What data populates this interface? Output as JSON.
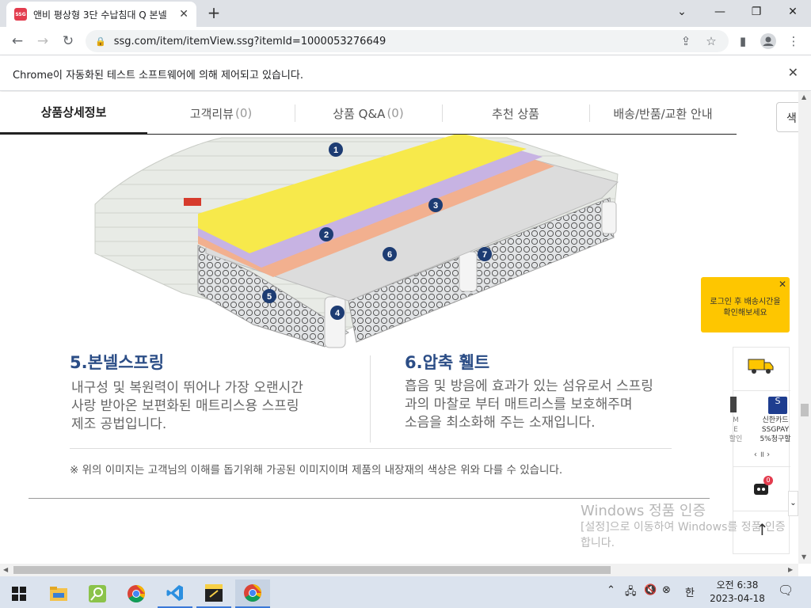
{
  "browser": {
    "tab_title": "앤비 평상형 3단 수납침대 Q 본넬",
    "favicon_text": "SSG",
    "new_tab": "+",
    "url": "ssg.com/item/itemView.ssg?itemId=1000053276649",
    "infobar": "Chrome이 자동화된 테스트 소프트웨어에 의해 제어되고 있습니다."
  },
  "page_tabs": [
    {
      "label": "상품상세정보",
      "count": ""
    },
    {
      "label": "고객리뷰",
      "count": "(0)"
    },
    {
      "label": "상품 Q&A",
      "count": "(0)"
    },
    {
      "label": "추천 상품",
      "count": ""
    },
    {
      "label": "배송/반품/교환 안내",
      "count": ""
    }
  ],
  "side_search": "색",
  "diagram_markers": [
    "1",
    "2",
    "3",
    "4",
    "5",
    "6",
    "7"
  ],
  "features": [
    {
      "title": "5.본넬스프링",
      "lines": [
        "내구성 및 복원력이 뛰어나 가장 오랜시간",
        "사랑 받아온 보편화된 매트리스용 스프링",
        "제조 공법입니다."
      ]
    },
    {
      "title": "6.압축 휄트",
      "lines": [
        "흡음 및 방음에 효과가 있는 섬유로서 스프링",
        "과의 마찰로 부터 매트리스를 보호해주며",
        "소음을 최소화해 주는 소재입니다."
      ]
    }
  ],
  "note": "※ 위의 이미지는 고객님의 이해를 돕기위해 가공된 이미지이며 제품의 내장재의 색상은 위와 다를 수 있습니다.",
  "floating": {
    "tooltip": [
      "로그인 후 배송시간을",
      "확인해보세요"
    ],
    "card_left": [
      "M",
      "E",
      "할인"
    ],
    "card_right": [
      "신한카드",
      "SSGPAY",
      "5%청구할"
    ],
    "cart_badge": "0"
  },
  "watermark": {
    "title": "Windows 정품 인증",
    "body": "[설정]으로 이동하여 Windows를 정품 인증합니다."
  },
  "taskbar": {
    "time": "오전 6:38",
    "date": "2023-04-18",
    "ime": "한"
  },
  "colors": {
    "accent_blue": "#2b4d86",
    "tooltip_yellow": "#fec600",
    "yellow_layer": "#f7e94b",
    "purple_layer": "#c7b3e3",
    "salmon_layer": "#f2b08f"
  }
}
